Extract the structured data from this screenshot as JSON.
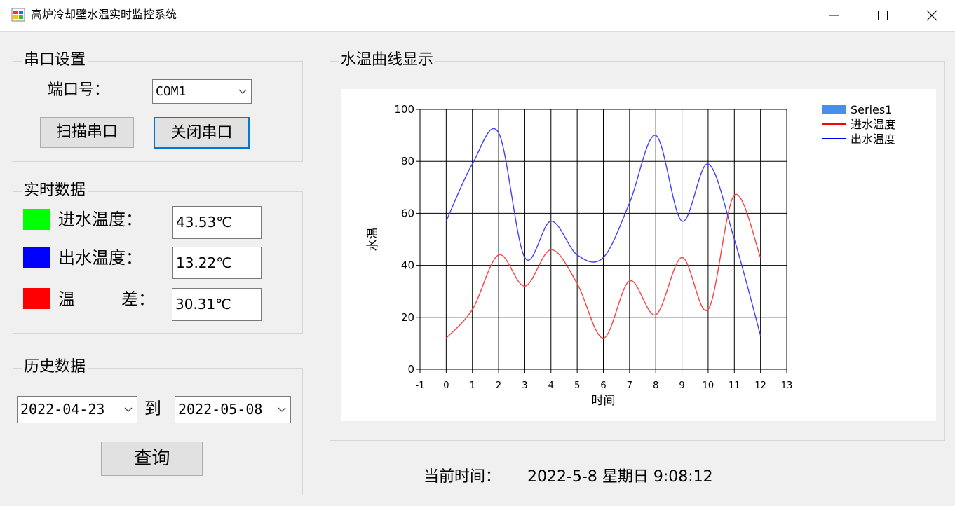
{
  "window": {
    "title": "高炉冷却壁水温实时监控系统"
  },
  "serial": {
    "group_title": "串口设置",
    "port_label": "端口号：",
    "port_value": "COM1",
    "scan_button": "扫描串口",
    "close_button": "关闭串口"
  },
  "realtime": {
    "group_title": "实时数据",
    "inlet_label": "进水温度：",
    "inlet_value": "43.53℃",
    "outlet_label": "出水温度：",
    "outlet_value": "13.22℃",
    "diff_label_1": "温",
    "diff_label_2": "差：",
    "diff_value": "30.31℃",
    "colors": {
      "inlet": "#00ff00",
      "outlet": "#0000ff",
      "diff": "#ff0000"
    }
  },
  "history": {
    "group_title": "历史数据",
    "start_date": "2022-04-23",
    "to_label": "到",
    "end_date": "2022-05-08",
    "query_button": "查询"
  },
  "chart_group": {
    "title": "水温曲线显示"
  },
  "clock": {
    "label": "当前时间：",
    "value": "2022-5-8 星期日 9:08:12"
  },
  "chart_data": {
    "type": "line",
    "xlabel": "时间",
    "ylabel": "水温",
    "xlim": [
      -1,
      13
    ],
    "ylim": [
      0,
      100
    ],
    "x_ticks": [
      -1,
      0,
      1,
      2,
      3,
      4,
      5,
      6,
      7,
      8,
      9,
      10,
      11,
      12,
      13
    ],
    "y_ticks": [
      0,
      20,
      40,
      60,
      80,
      100
    ],
    "grid": true,
    "legend_position": "top-right",
    "legend": [
      {
        "name": "Series1",
        "color": "#4a8fe7",
        "style": "box"
      },
      {
        "name": "进水温度",
        "color": "#ff0000",
        "style": "line"
      },
      {
        "name": "出水温度",
        "color": "#0000ff",
        "style": "line"
      }
    ],
    "x": [
      0,
      1,
      2,
      3,
      4,
      5,
      6,
      7,
      8,
      9,
      10,
      11,
      12
    ],
    "series": [
      {
        "name": "进水温度",
        "color": "#ff4040",
        "values": [
          12,
          23,
          44,
          32,
          46,
          33,
          12,
          34,
          21,
          43,
          23,
          67,
          43
        ]
      },
      {
        "name": "出水温度",
        "color": "#4040ff",
        "values": [
          57,
          79,
          91,
          43,
          57,
          44,
          43,
          64,
          90,
          57,
          79,
          50,
          13
        ]
      }
    ]
  }
}
